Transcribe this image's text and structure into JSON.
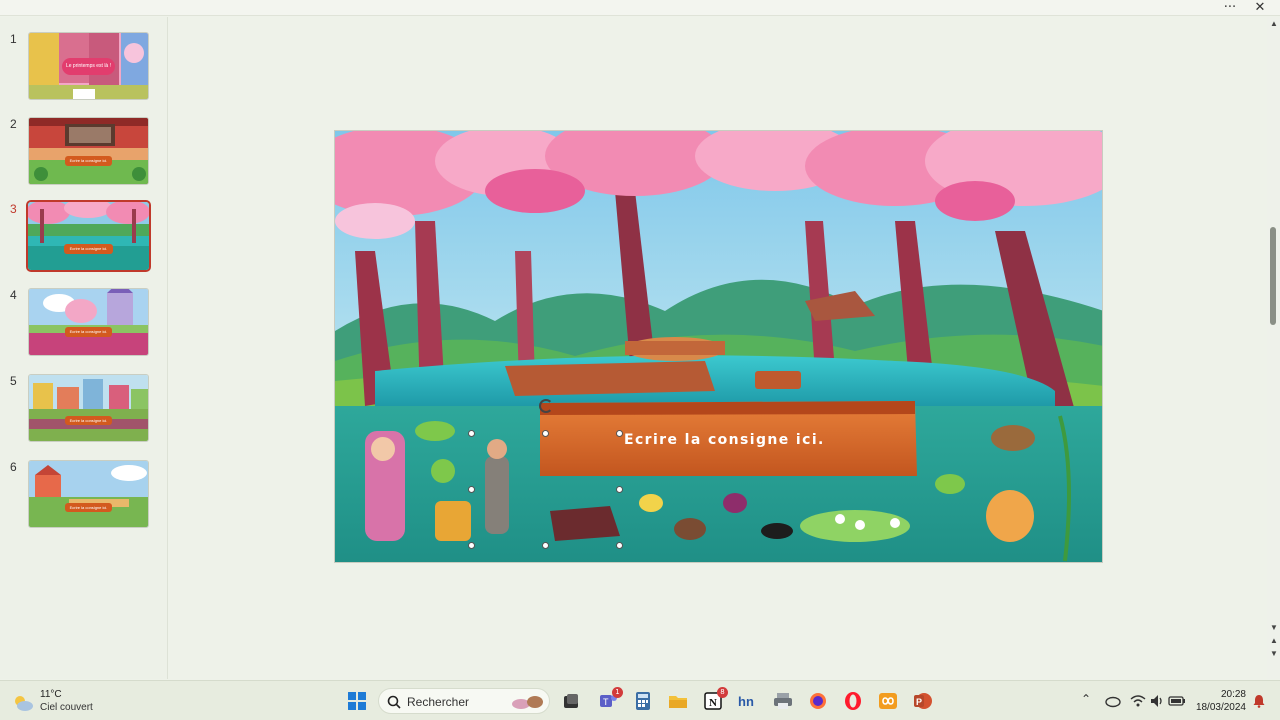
{
  "window": {
    "more_label": "···",
    "close_label": "✕"
  },
  "slides": [
    {
      "number": "1",
      "title": "Le printemps est là !",
      "scene": "street"
    },
    {
      "number": "2",
      "title": "Ecrire la consigne ici.",
      "scene": "house"
    },
    {
      "number": "3",
      "title": "Ecrire la consigne ici.",
      "scene": "lake",
      "active": true
    },
    {
      "number": "4",
      "title": "Ecrire la consigne ici.",
      "scene": "castle"
    },
    {
      "number": "5",
      "title": "Ecrire la consigne ici.",
      "scene": "city"
    },
    {
      "number": "6",
      "title": "Ecrire la consigne ici.",
      "scene": "park"
    }
  ],
  "current_slide": {
    "instruction_text": "Ecrire la consigne ici."
  },
  "taskbar": {
    "weather_temp": "11°C",
    "weather_condition": "Ciel couvert",
    "search_placeholder": "Rechercher",
    "teams_badge": "1",
    "notion_badge": "8",
    "time": "20:28",
    "date": "18/03/2024"
  },
  "colors": {
    "accent": "#c0392b",
    "banner": "#d35a1e",
    "water": "#27b3a2",
    "blossom": "#f28bb3"
  },
  "icons": [
    "weather-cloud-icon",
    "windows-start-icon",
    "search-icon",
    "task-view-icon",
    "teams-icon",
    "calculator-icon",
    "file-explorer-icon",
    "notion-icon",
    "hn-icon",
    "printer-icon",
    "firefox-icon",
    "opera-icon",
    "infinity-icon",
    "powerpoint-icon",
    "chevron-up-icon",
    "onedrive-icon",
    "wifi-icon",
    "volume-icon",
    "battery-icon",
    "notification-bell-icon"
  ]
}
